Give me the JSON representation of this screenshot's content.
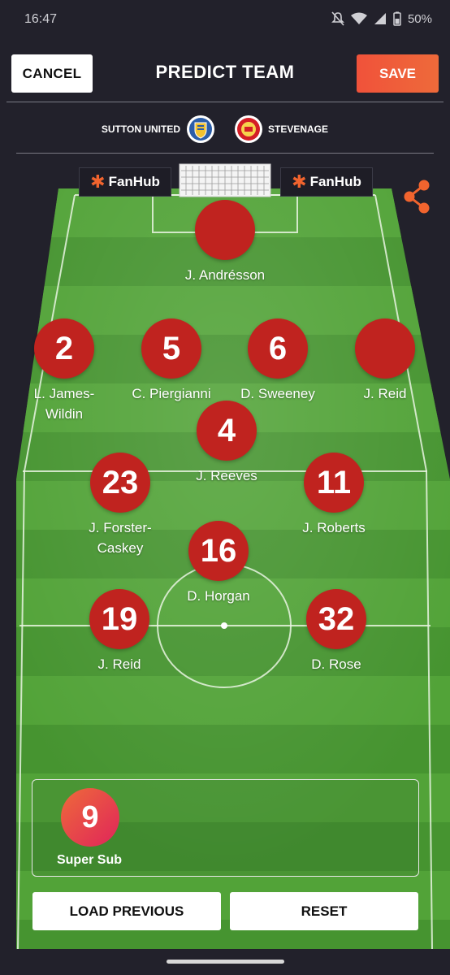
{
  "status": {
    "time": "16:47",
    "battery": "50%"
  },
  "header": {
    "cancel_label": "CANCEL",
    "title": "PREDICT TEAM",
    "save_label": "SAVE"
  },
  "match": {
    "home": "SUTTON UNITED",
    "away": "STEVENAGE"
  },
  "boards": {
    "left": "FanHub",
    "right": "FanHub"
  },
  "players": [
    {
      "id": "gk",
      "number": "",
      "name": "J. Andrésson"
    },
    {
      "id": "rb",
      "number": "2",
      "name": "L. James-Wildin"
    },
    {
      "id": "cb1",
      "number": "5",
      "name": "C. Piergianni"
    },
    {
      "id": "cb2",
      "number": "6",
      "name": "D. Sweeney"
    },
    {
      "id": "lb",
      "number": "",
      "name": "J. Reid"
    },
    {
      "id": "cm",
      "number": "4",
      "name": "J. Reeves"
    },
    {
      "id": "rm",
      "number": "23",
      "name": "J. Forster-Caskey"
    },
    {
      "id": "lm",
      "number": "11",
      "name": "J. Roberts"
    },
    {
      "id": "am",
      "number": "16",
      "name": "D. Horgan"
    },
    {
      "id": "st1",
      "number": "19",
      "name": "J. Reid"
    },
    {
      "id": "st2",
      "number": "32",
      "name": "D. Rose"
    }
  ],
  "super_sub": {
    "number": "9",
    "label": "Super Sub"
  },
  "actions": {
    "load_previous": "LOAD PREVIOUS",
    "reset": "RESET"
  },
  "colors": {
    "background": "#22212b",
    "player_disc": "#c0231f",
    "accent": "#f0523a",
    "pitch_dark": "#3f8a2c",
    "pitch_light": "#58a63a"
  }
}
